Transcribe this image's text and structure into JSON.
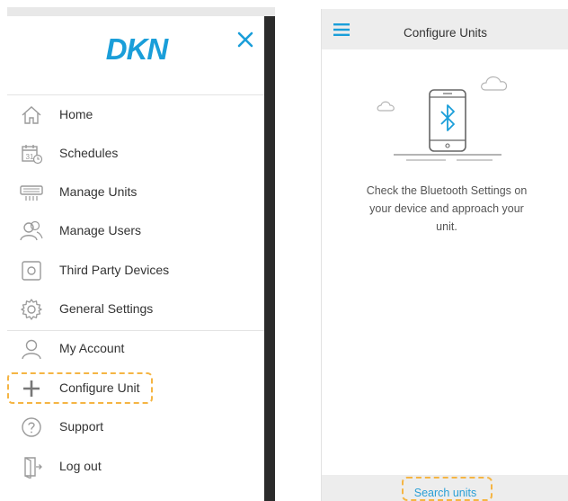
{
  "drawer": {
    "brand": "DKN",
    "close_icon": "close-icon",
    "items": [
      {
        "label": "Home",
        "icon": "home-icon"
      },
      {
        "label": "Schedules",
        "icon": "calendar-icon"
      },
      {
        "label": "Manage Units",
        "icon": "air-unit-icon"
      },
      {
        "label": "Manage Users",
        "icon": "users-icon"
      },
      {
        "label": "Third Party Devices",
        "icon": "device-icon"
      },
      {
        "label": "General Settings",
        "icon": "gear-icon"
      },
      {
        "label": "My Account",
        "icon": "user-icon"
      },
      {
        "label": "Configure Unit",
        "icon": "plus-icon"
      },
      {
        "label": "Support",
        "icon": "help-icon"
      },
      {
        "label": "Log out",
        "icon": "logout-icon"
      }
    ],
    "calendar_day": "31"
  },
  "configure": {
    "title": "Configure Units",
    "menu_icon": "hamburger-icon",
    "illustration_icon": "bluetooth-phone-icon",
    "instruction": "Check the Bluetooth Settings on your device and approach your unit.",
    "search_label": "Search units"
  },
  "colors": {
    "brand": "#1a9ed9",
    "icon": "#9a9a9a",
    "highlight": "#f5b544",
    "link": "#2a9fd6"
  }
}
